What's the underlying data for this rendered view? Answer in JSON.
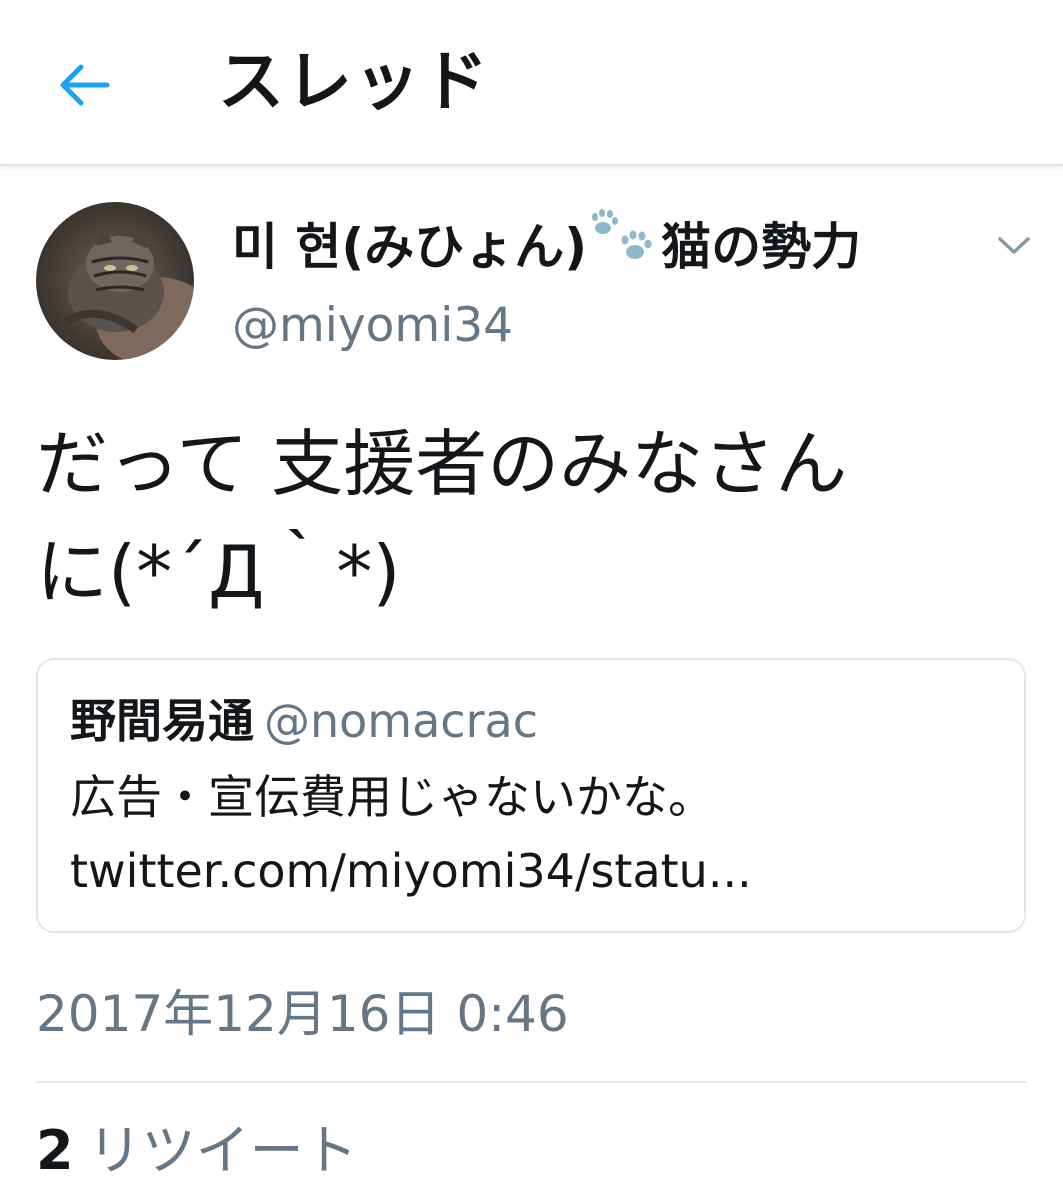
{
  "header": {
    "title": "スレッド",
    "back_icon": "back-arrow-icon"
  },
  "colors": {
    "accent": "#1da1f2",
    "secondary_text": "#657786",
    "border": "#e1e8ed",
    "paw": "#8fb9c9"
  },
  "tweet": {
    "display_name_prefix": "미 현(みひょん)",
    "display_name_emoji": "paw-prints-icon",
    "display_name_suffix": "猫の勢力",
    "handle": "@miyomi34",
    "text_line1": "だって 支援者のみなさん",
    "text_line2": "に(*´Д｀*)",
    "timestamp": "2017年12月16日 0:46",
    "retweet_count": "2",
    "retweet_label": "リツイート"
  },
  "quote": {
    "name": "野間易通",
    "handle": "@nomacrac",
    "text": "広告・宣伝費用じゃないかな。",
    "link": "twitter.com/miyomi34/statu..."
  }
}
